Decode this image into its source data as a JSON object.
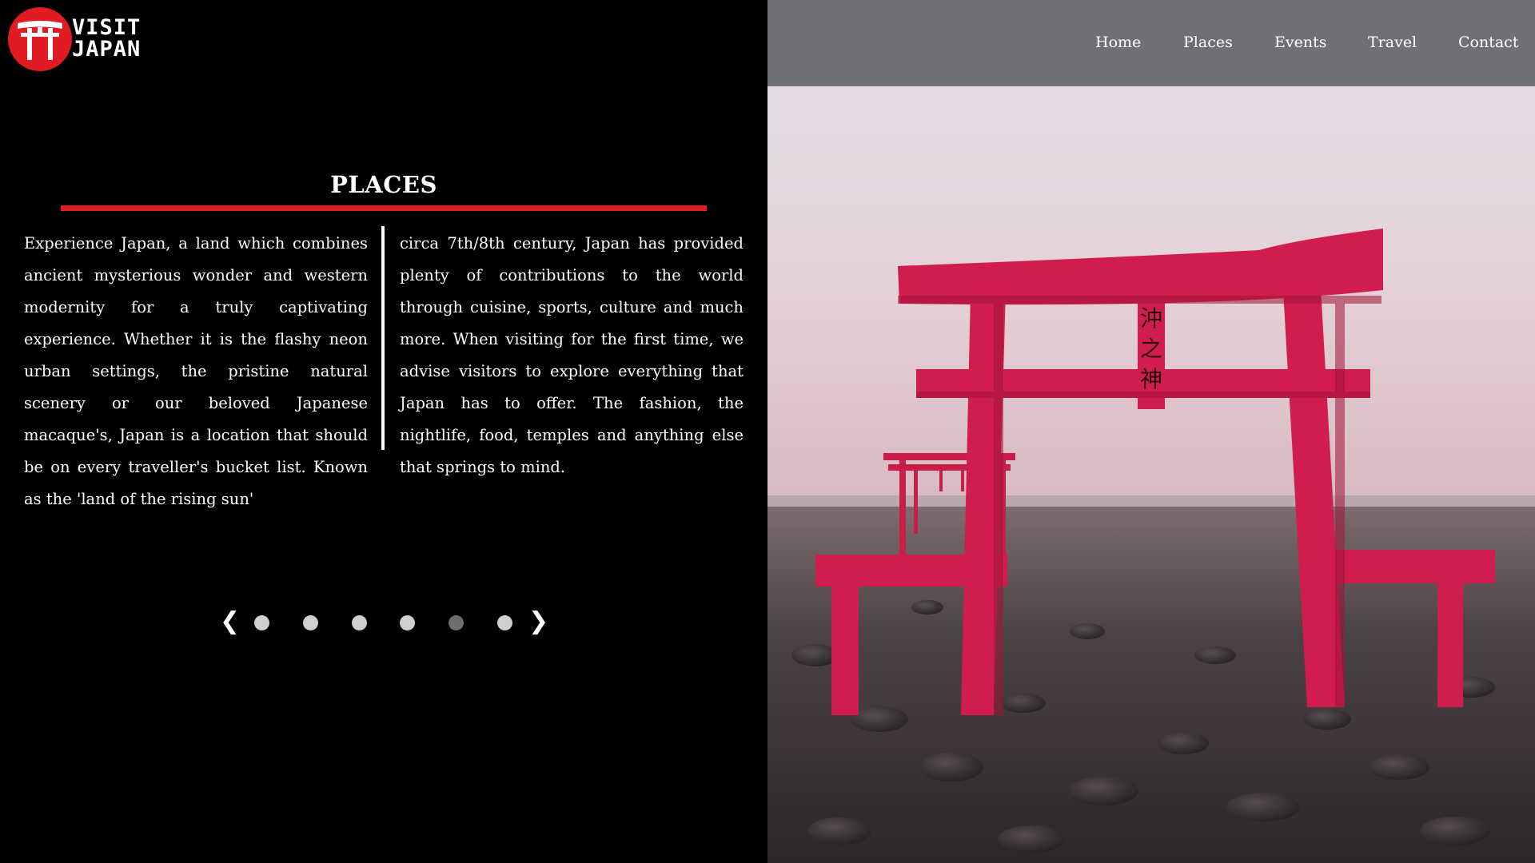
{
  "brand": {
    "logo_line1": "VISIT",
    "logo_line2": "JAPAN",
    "logo_icon": "torii-gate-icon",
    "accent_color": "#e01b24"
  },
  "nav": {
    "items": [
      {
        "label": "Home"
      },
      {
        "label": "Places"
      },
      {
        "label": "Events"
      },
      {
        "label": "Travel"
      },
      {
        "label": "Contact"
      }
    ]
  },
  "section": {
    "title": "PLACES",
    "column_left": "Experience Japan, a land which combines ancient mysterious wonder and western modernity for a truly captivating experience. Whether it is the flashy neon urban settings, the pristine natural scenery or our beloved Japanese macaque's, Japan is a location that should be on every traveller's bucket list. Known as the 'land of the rising sun'",
    "column_right": "circa 7th/8th century, Japan has provided plenty of contributions to the world through cuisine, sports, culture and much more. When visiting for the first time, we advise visitors to explore everything that Japan has to offer. The fashion, the nightlife, food, temples and anything else that springs to mind."
  },
  "carousel": {
    "prev_icon": "chevron-left-icon",
    "next_icon": "chevron-right-icon",
    "prev_glyph": "❮",
    "next_glyph": "❯",
    "slide_count": 6,
    "active_index": 4
  },
  "hero_image": {
    "sign_chars": [
      "沖",
      "之",
      "神"
    ]
  }
}
